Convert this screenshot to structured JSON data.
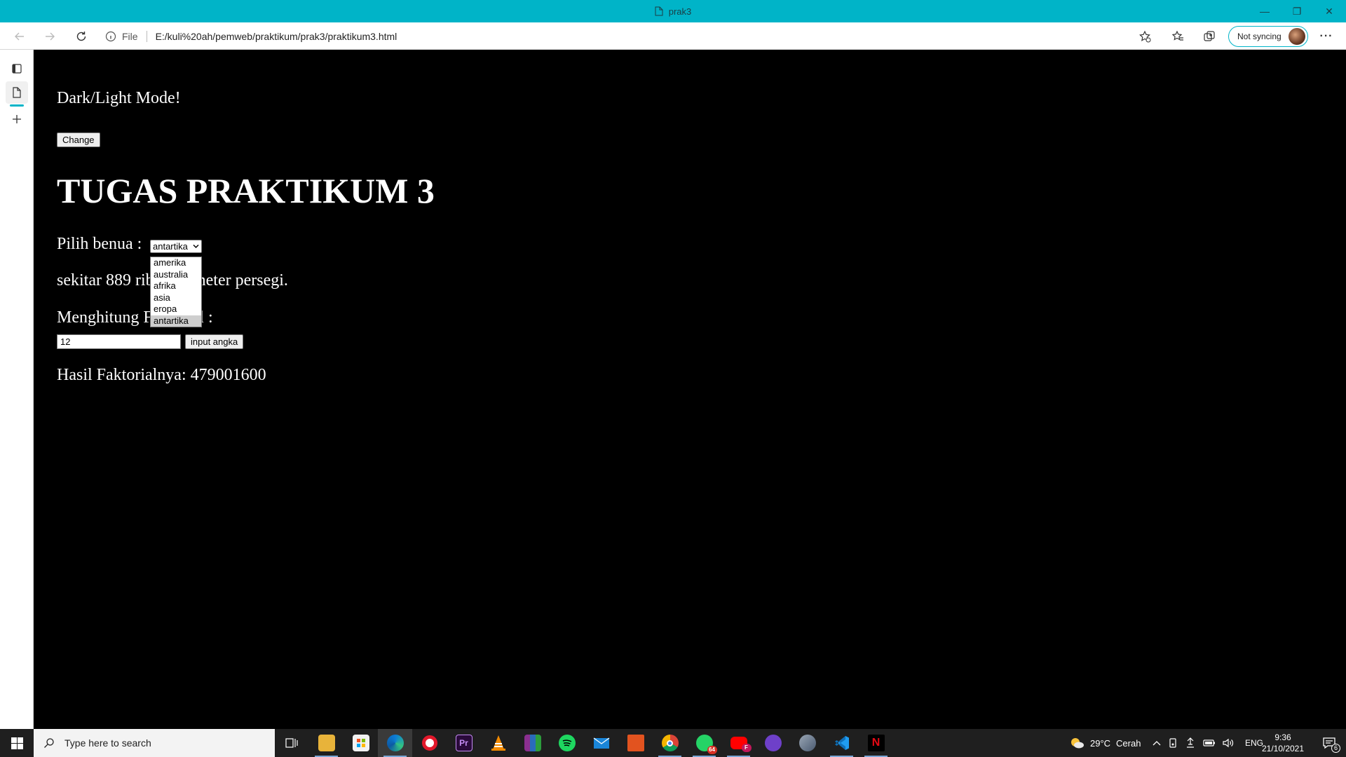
{
  "window": {
    "title": "prak3",
    "minimize_glyph": "—",
    "restore_glyph": "❐",
    "close_glyph": "✕"
  },
  "toolbar": {
    "address_scheme": "File",
    "address_url": "E:/kuli%20ah/pemweb/praktikum/prak3/praktikum3.html",
    "sync_label": "Not syncing",
    "more_glyph": "···"
  },
  "page": {
    "mode_text": "Dark/Light Mode!",
    "change_label": "Change",
    "heading": "TUGAS PRAKTIKUM 3",
    "benua_label": "Pilih benua :",
    "selected_benua": "antartika",
    "benua_options": [
      "amerika",
      "australia",
      "afrika",
      "asia",
      "eropa",
      "antartika"
    ],
    "luas_text": "sekitar 889 ribu kilometer persegi.",
    "hitung_label": "Menghitung Faktorial :",
    "number_value": "12",
    "input_button_label": "input angka",
    "hasil_text": "Hasil Faktorialnya: 479001600"
  },
  "taskbar": {
    "search_placeholder": "Type here to search",
    "whatsapp_badge": "64",
    "youtube_badge": "F",
    "netflix_label": "N",
    "premiere_label": "Pr",
    "weather_temp": "29°C",
    "weather_desc": "Cerah",
    "lang": "ENG",
    "time": "9:36",
    "date": "21/10/2021",
    "notif_count": "6"
  },
  "colors": {
    "titlebar": "#00b4c8",
    "page_background": "#000000",
    "page_text": "#ffffff",
    "taskbar": "#1f1f1f"
  }
}
